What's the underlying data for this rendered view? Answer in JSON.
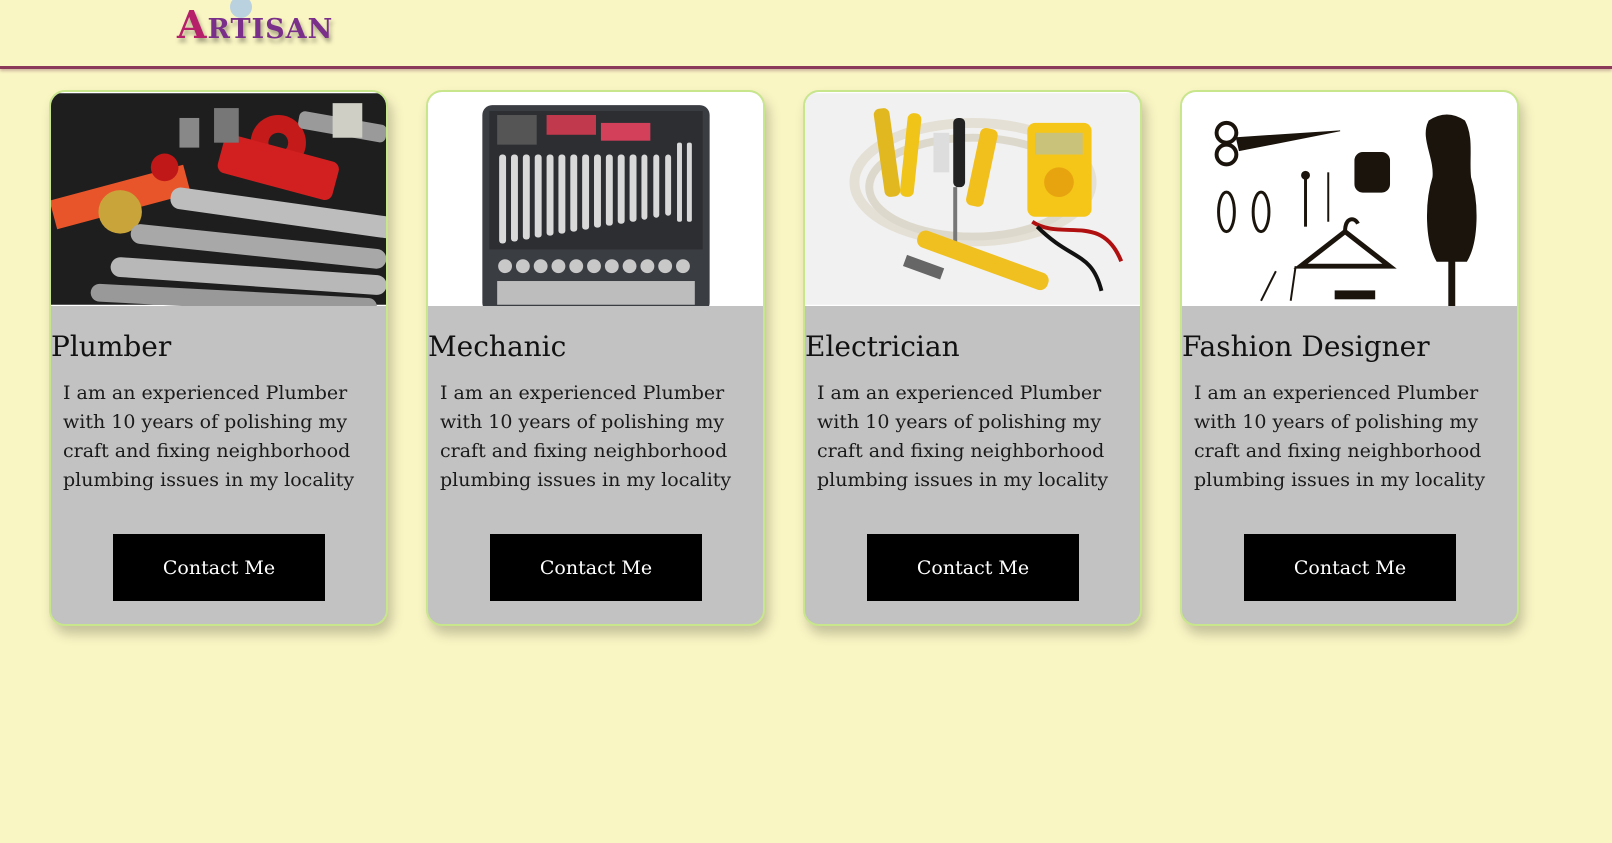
{
  "header": {
    "logo_first_letter": "A",
    "logo_rest": "RTISAN"
  },
  "cards": [
    {
      "title": "Plumber",
      "description": "I am an experienced Plumber with 10 years of polishing my craft and fixing neighborhood plumbing issues in my locality",
      "button_label": "Contact Me",
      "image": "plumbing-tools"
    },
    {
      "title": "Mechanic",
      "description": "I am an experienced Plumber with 10 years of polishing my craft and fixing neighborhood plumbing issues in my locality",
      "button_label": "Contact Me",
      "image": "mechanic-toolbox"
    },
    {
      "title": "Electrician",
      "description": "I am an experienced Plumber with 10 years of polishing my craft and fixing neighborhood plumbing issues in my locality",
      "button_label": "Contact Me",
      "image": "electrician-tools"
    },
    {
      "title": "Fashion Designer",
      "description": "I am an experienced Plumber with 10 years of polishing my craft and fixing neighborhood plumbing issues in my locality",
      "button_label": "Contact Me",
      "image": "sewing-tools"
    }
  ],
  "colors": {
    "page_bg": "#faf6c4",
    "header_border": "#8b3a5a",
    "card_bg": "#c2c2c2",
    "card_border": "#c8e68c",
    "button_bg": "#000000",
    "button_text": "#ffffff",
    "logo": "#b6206a"
  }
}
